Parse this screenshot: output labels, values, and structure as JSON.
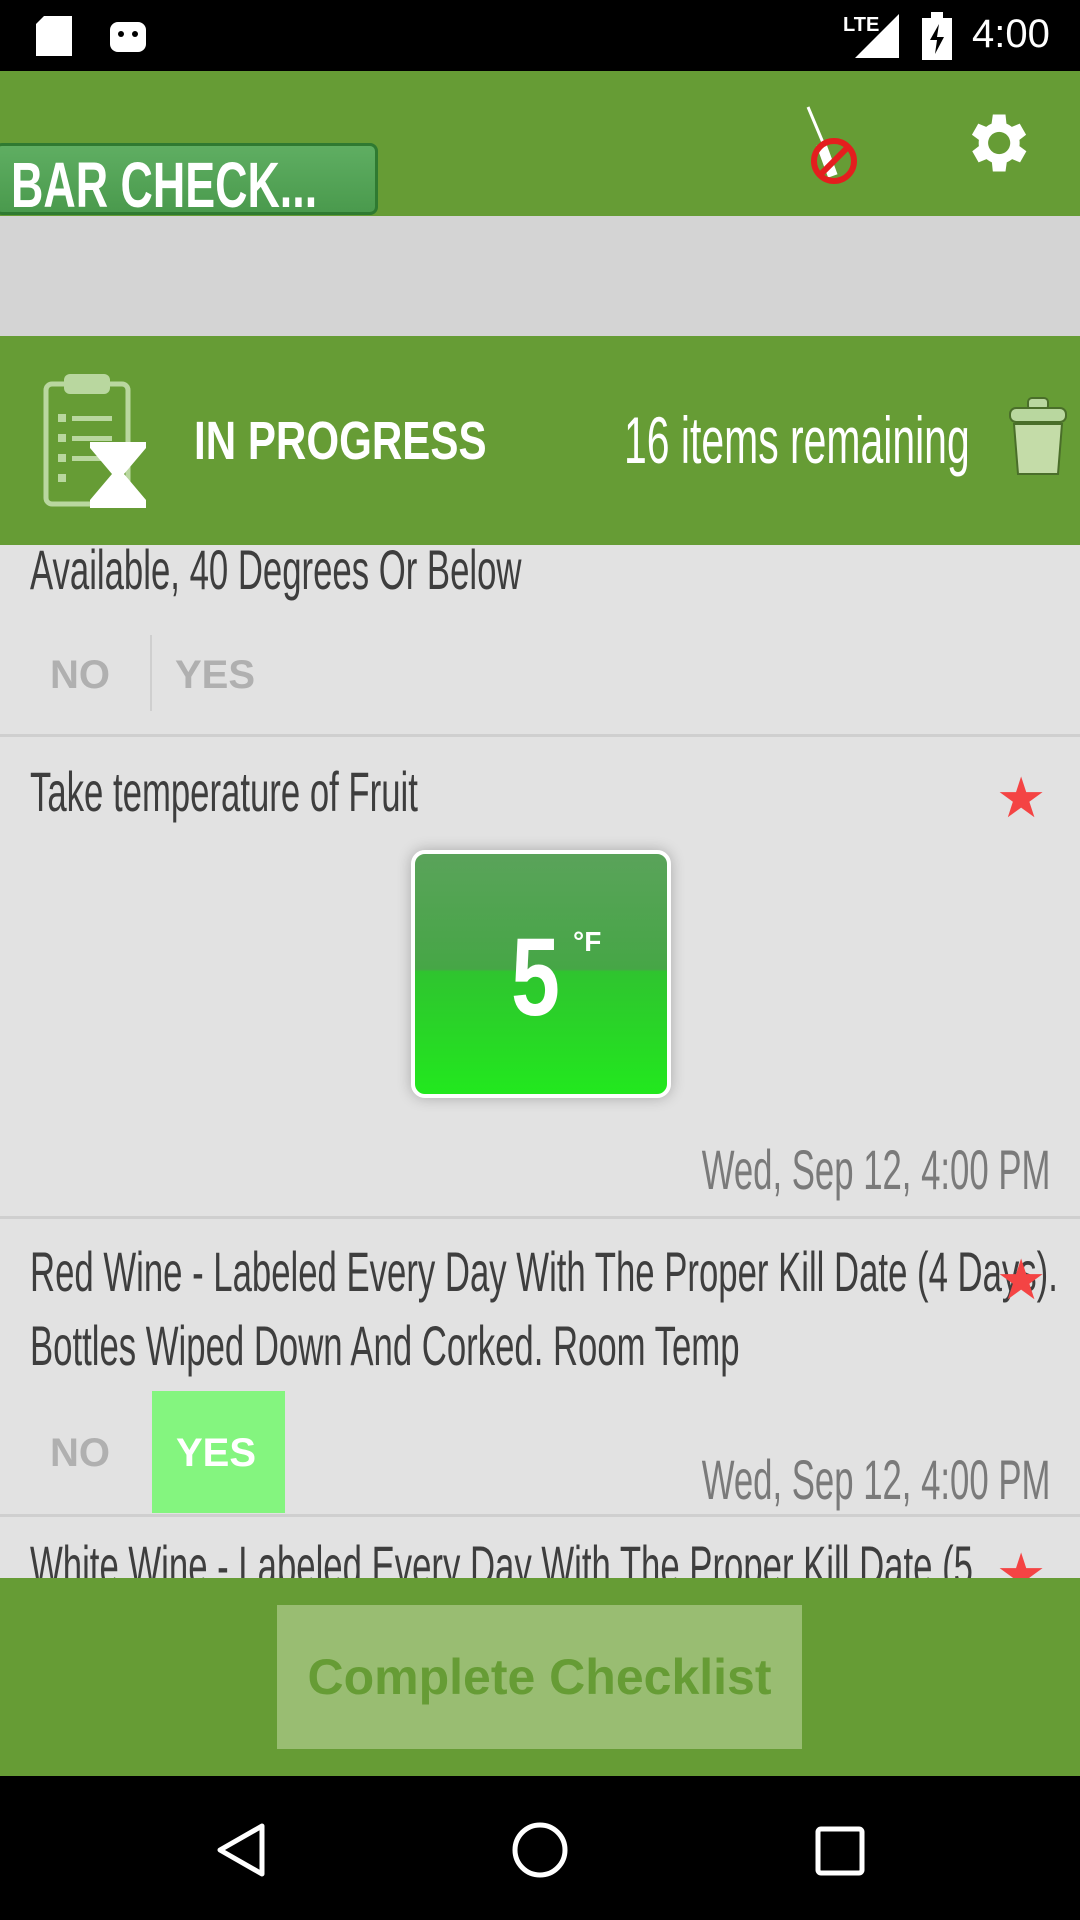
{
  "status_bar": {
    "network": "LTE",
    "time": "4:00",
    "icons": [
      "sd-card-icon",
      "android-icon",
      "signal-icon",
      "battery-charging-icon"
    ]
  },
  "header": {
    "title": "BAR CHECK...",
    "icons": [
      "no-thermometer-icon",
      "gear-icon"
    ]
  },
  "progress": {
    "status": "IN PROGRESS",
    "remaining": "16 items remaining",
    "icons": [
      "clipboard-hourglass-icon",
      "trash-icon"
    ]
  },
  "items": [
    {
      "title": "Available, 40 Degrees Or Below",
      "no": "NO",
      "yes": "YES"
    },
    {
      "title": "Take temperature of Fruit",
      "temperature": "5",
      "unit": "°F",
      "timestamp": "Wed, Sep 12, 4:00 PM"
    },
    {
      "title_line1": "Red Wine - Labeled Every Day With The Proper Kill Date (4 Days).",
      "title_line2": "Bottles Wiped Down And Corked. Room Temp",
      "no": "NO",
      "yes": "YES",
      "selected": "YES",
      "timestamp": "Wed, Sep 12, 4:00 PM"
    },
    {
      "title": "White Wine - Labeled Every Day With The Proper Kill Date (5"
    }
  ],
  "colors": {
    "brand_green": "#669c35",
    "star": "#f44444",
    "yes_selected": "#84f57f"
  },
  "footer": {
    "complete_label": "Complete Checklist"
  },
  "nav": {
    "icons": [
      "back-icon",
      "home-icon",
      "recents-icon"
    ]
  }
}
